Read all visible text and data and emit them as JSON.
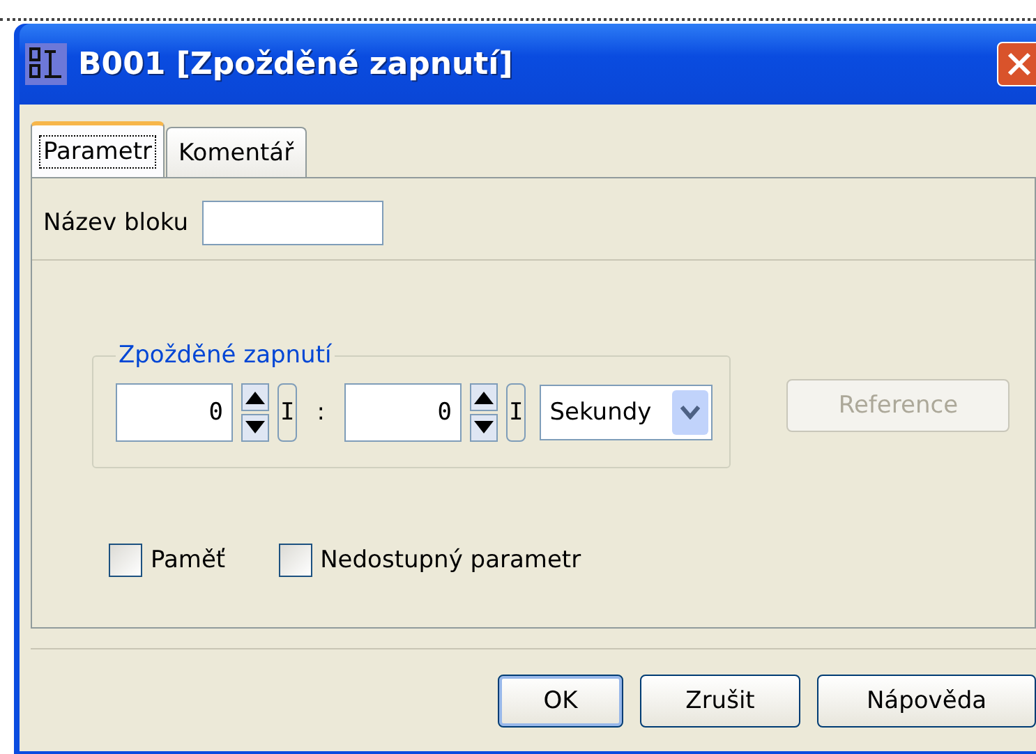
{
  "window": {
    "title": "B001 [Zpožděné zapnutí]"
  },
  "tabs": [
    {
      "label": "Parametr",
      "selected": true
    },
    {
      "label": "Komentář",
      "selected": false
    }
  ],
  "block_name": {
    "label": "Název bloku"
  },
  "group": {
    "title": "Zpožděné zapnutí",
    "fields": [
      {
        "value": "0",
        "marker": "I"
      },
      {
        "value": "0",
        "marker": "I"
      }
    ],
    "separator": ":",
    "unit": "Sekundy"
  },
  "reference_button": {
    "label": "Reference",
    "disabled": true
  },
  "checkboxes": [
    {
      "label": "Paměť",
      "checked": false
    },
    {
      "label": "Nedostupný parametr",
      "checked": false
    }
  ],
  "buttons": [
    {
      "label": "OK",
      "default": true
    },
    {
      "label": "Zrušit",
      "default": false
    },
    {
      "label": "Nápověda",
      "default": false
    }
  ]
}
